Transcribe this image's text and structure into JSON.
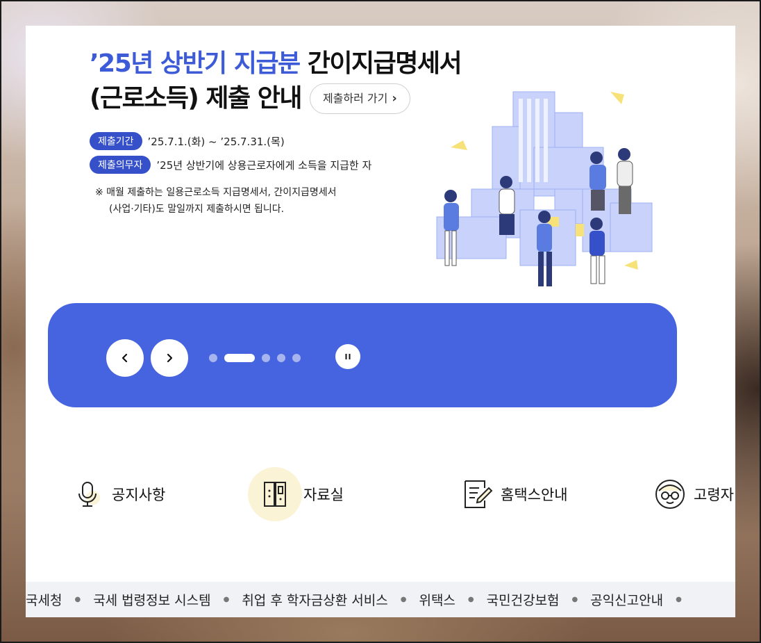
{
  "banner": {
    "title_line1_blue": "’25년 상반기 지급분",
    "title_line1_black": " 간이지급명세서",
    "title_line2": "(근로소득) 제출 안내",
    "go_button": "제출하러 가기",
    "period_label": "제출기간",
    "period_value": "’25.7.1.(화) ~ ’25.7.31.(목)",
    "duty_label": "제출의무자",
    "duty_value": "’25년 상반기에 상용근로자에게 소득을 지급한 자",
    "note_line1": "※ 매월 제출하는 일용근로소득 지급명세서, 간이지급명세서",
    "note_line2": "(사업·기타)도 말일까지 제출하시면 됩니다."
  },
  "slider": {
    "prev_icon": "chevron-left-icon",
    "next_icon": "chevron-right-icon",
    "pause_icon": "pause-icon",
    "active_index": 1,
    "total": 5
  },
  "quick_links": [
    {
      "label": "공지사항",
      "icon": "microphone-icon"
    },
    {
      "label": "자료실",
      "icon": "archive-icon"
    },
    {
      "label": "홈택스안내",
      "icon": "document-edit-icon"
    },
    {
      "label": "고령자",
      "icon": "elder-icon"
    }
  ],
  "footer_links": [
    "국세청",
    "국세 법령정보 시스템",
    "취업 후 학자금상환 서비스",
    "위택스",
    "국민건강보험",
    "공익신고안내"
  ],
  "colors": {
    "accent": "#4764e0",
    "pill": "#3550c8",
    "highlight": "#fbf3d6"
  }
}
